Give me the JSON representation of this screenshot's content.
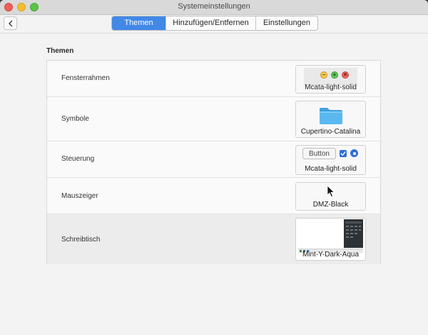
{
  "window": {
    "title": "Systemeinstellungen"
  },
  "toolbar": {
    "tabs": [
      {
        "label": "Themen",
        "active": true
      },
      {
        "label": "Hinzufügen/Entfernen",
        "active": false
      },
      {
        "label": "Einstellungen",
        "active": false
      }
    ]
  },
  "section": {
    "title": "Themen"
  },
  "themes": [
    {
      "label": "Fensterrahmen",
      "value": "Mcata-light-solid",
      "icon": "window-controls-preview"
    },
    {
      "label": "Symbole",
      "value": "Cupertino-Catalina",
      "icon": "folder-icon"
    },
    {
      "label": "Steuerung",
      "value": "Mcata-light-solid",
      "icon": "controls-preview",
      "preview_button": "Button"
    },
    {
      "label": "Mauszeiger",
      "value": "DMZ-Black",
      "icon": "mouse-cursor-icon"
    },
    {
      "label": "Schreibtisch",
      "value": "Mint-Y-Dark-Aqua",
      "icon": "desktop-preview",
      "highlighted": true
    }
  ],
  "colors": {
    "accent": "#4188e7",
    "folder": "#5ab8f0",
    "check": "#2f6fd6"
  }
}
